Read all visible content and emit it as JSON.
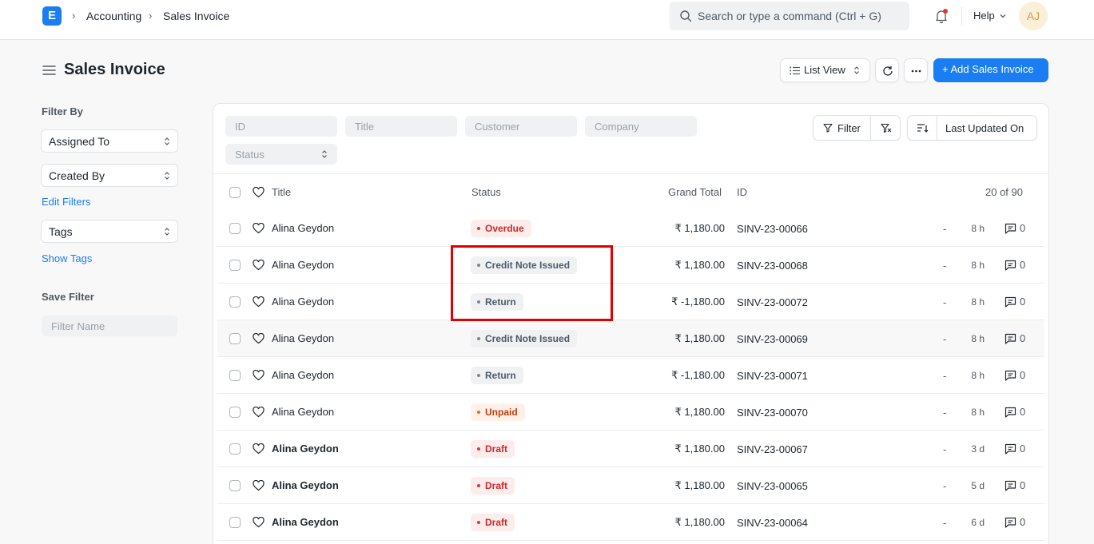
{
  "navbar": {
    "logo_letter": "E",
    "breadcrumbs": [
      "Accounting",
      "Sales Invoice"
    ],
    "search_placeholder": "Search or type a command (Ctrl + G)",
    "help_label": "Help",
    "avatar_initials": "AJ"
  },
  "page": {
    "title": "Sales Invoice",
    "list_view_label": "List View",
    "add_button_label": "+ Add Sales Invoice"
  },
  "sidebar": {
    "filter_by_label": "Filter By",
    "assigned_to_label": "Assigned To",
    "created_by_label": "Created By",
    "edit_filters_label": "Edit Filters",
    "tags_label": "Tags",
    "show_tags_label": "Show Tags",
    "save_filter_label": "Save Filter",
    "filter_name_placeholder": "Filter Name"
  },
  "filters": {
    "id_placeholder": "ID",
    "title_placeholder": "Title",
    "customer_placeholder": "Customer",
    "company_placeholder": "Company",
    "status_placeholder": "Status",
    "filter_button_label": "Filter",
    "sort_label": "Last Updated On"
  },
  "table": {
    "headers": {
      "title": "Title",
      "status": "Status",
      "grand_total": "Grand Total",
      "id": "ID",
      "count": "20 of 90"
    },
    "rows": [
      {
        "title": "Alina Geydon",
        "status": "Overdue",
        "amount": "₹ 1,180.00",
        "id": "SINV-23-00066",
        "dash": "-",
        "time": "8 h",
        "comments": "0"
      },
      {
        "title": "Alina Geydon",
        "status": "Credit Note Issued",
        "amount": "₹ 1,180.00",
        "id": "SINV-23-00068",
        "dash": "-",
        "time": "8 h",
        "comments": "0"
      },
      {
        "title": "Alina Geydon",
        "status": "Return",
        "amount": "₹ -1,180.00",
        "id": "SINV-23-00072",
        "dash": "-",
        "time": "8 h",
        "comments": "0"
      },
      {
        "title": "Alina Geydon",
        "status": "Credit Note Issued",
        "amount": "₹ 1,180.00",
        "id": "SINV-23-00069",
        "dash": "-",
        "time": "8 h",
        "comments": "0"
      },
      {
        "title": "Alina Geydon",
        "status": "Return",
        "amount": "₹ -1,180.00",
        "id": "SINV-23-00071",
        "dash": "-",
        "time": "8 h",
        "comments": "0"
      },
      {
        "title": "Alina Geydon",
        "status": "Unpaid",
        "amount": "₹ 1,180.00",
        "id": "SINV-23-00070",
        "dash": "-",
        "time": "8 h",
        "comments": "0"
      },
      {
        "title": "Alina Geydon",
        "status": "Draft",
        "amount": "₹ 1,180.00",
        "id": "SINV-23-00067",
        "dash": "-",
        "time": "3 d",
        "comments": "0"
      },
      {
        "title": "Alina Geydon",
        "status": "Draft",
        "amount": "₹ 1,180.00",
        "id": "SINV-23-00065",
        "dash": "-",
        "time": "5 d",
        "comments": "0"
      },
      {
        "title": "Alina Geydon",
        "status": "Draft",
        "amount": "₹ 1,180.00",
        "id": "SINV-23-00064",
        "dash": "-",
        "time": "6 d",
        "comments": "0"
      }
    ]
  },
  "colors": {
    "accent": "#1a7ef2",
    "status_red": "#cc2929",
    "status_orange": "#bd3e0c",
    "status_gray": "#4c5a67",
    "highlight_box": "#e00000"
  }
}
